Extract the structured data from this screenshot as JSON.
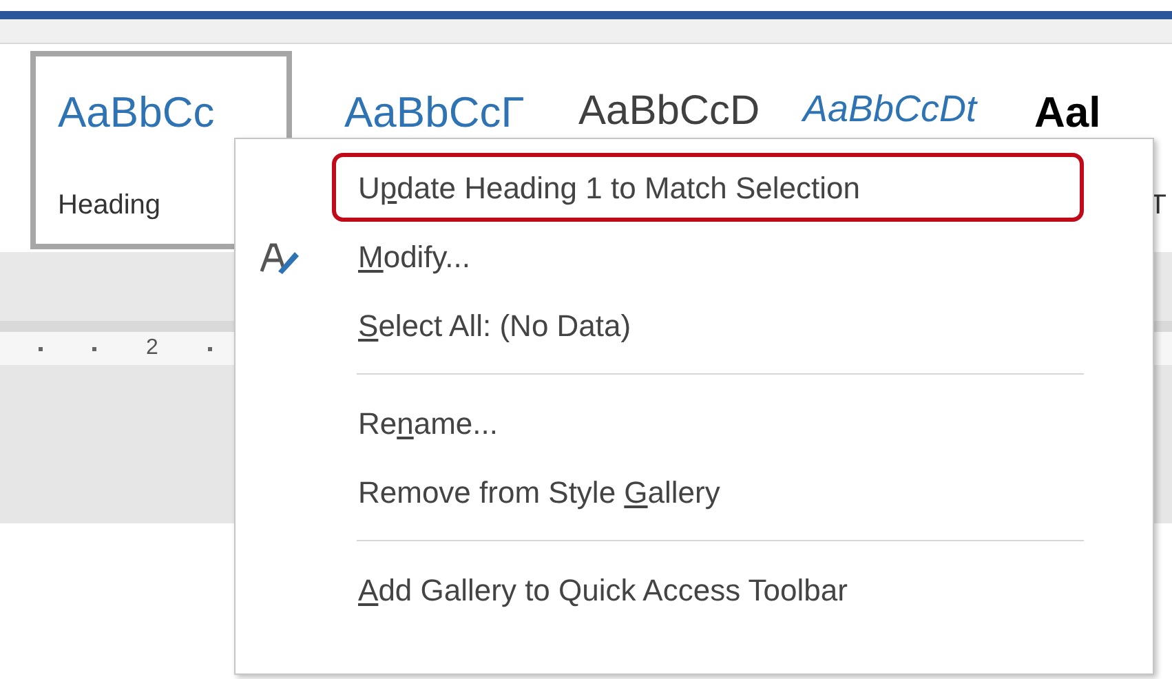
{
  "style_gallery": [
    {
      "sample": "AaBbCc",
      "label": "Heading",
      "selected": true,
      "kind": "heading"
    },
    {
      "sample": "AaBbCcΓ",
      "selected": false,
      "kind": "heading"
    },
    {
      "sample": "AaBbCcD",
      "selected": false,
      "kind": "title"
    },
    {
      "sample": "AaBbCcDt",
      "selected": false,
      "kind": "emphasis"
    },
    {
      "sample": "Aal",
      "label": "T",
      "selected": false,
      "kind": "strong"
    }
  ],
  "ruler": {
    "number": "2"
  },
  "context_menu": [
    {
      "kind": "item",
      "before": "U",
      "key": "p",
      "after": "date Heading 1 to Match Selection",
      "highlighted": true
    },
    {
      "kind": "item",
      "key": "M",
      "after": "odify...",
      "icon": true,
      "highlighted": false
    },
    {
      "kind": "item",
      "key": "S",
      "after": "elect All: (No Data)",
      "highlighted": false
    },
    {
      "kind": "separator"
    },
    {
      "kind": "item",
      "before": "Re",
      "key": "n",
      "after": "ame...",
      "highlighted": false
    },
    {
      "kind": "item",
      "before": "Remove from Style ",
      "key": "G",
      "after": "allery",
      "highlighted": false
    },
    {
      "kind": "separator"
    },
    {
      "kind": "item",
      "key": "A",
      "after": "dd Gallery to Quick Access Toolbar",
      "highlighted": false
    }
  ]
}
